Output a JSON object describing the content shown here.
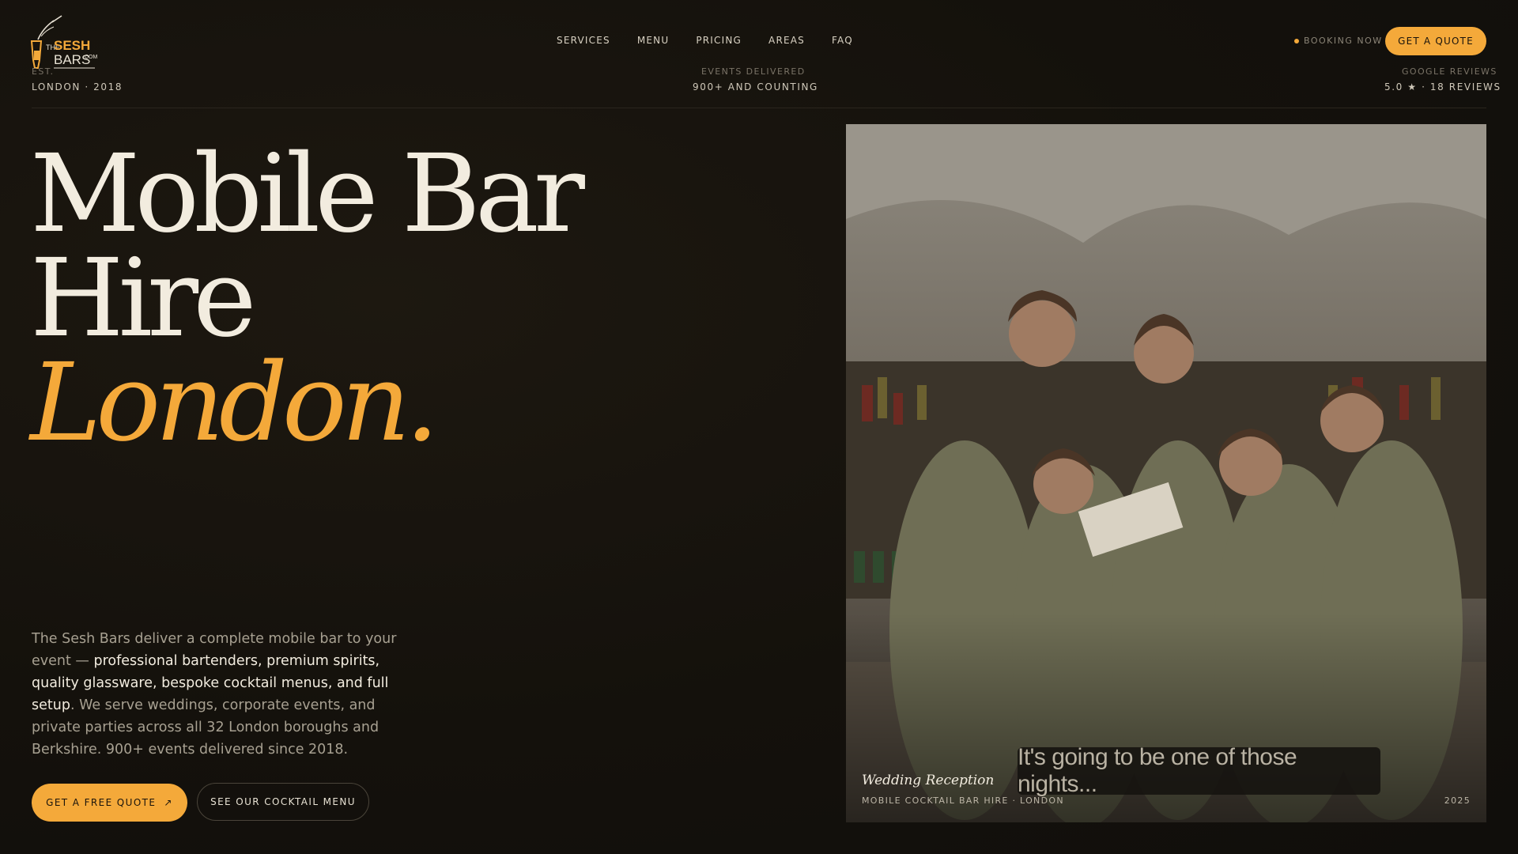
{
  "brand": {
    "logo_the": "THE",
    "logo_sesh": "SESH",
    "logo_bars": "BARS",
    "logo_com": ".COM",
    "accent_color": "#f4a93a"
  },
  "nav": {
    "items": [
      {
        "label": "SERVICES"
      },
      {
        "label": "MENU"
      },
      {
        "label": "PRICING"
      },
      {
        "label": "AREAS"
      },
      {
        "label": "FAQ"
      }
    ]
  },
  "header": {
    "booking_status": "BOOKING NOW",
    "quote_button": "GET A QUOTE"
  },
  "stats": {
    "est_label": "EST.",
    "est_value": "LONDON · 2018",
    "events_label": "EVENTS DELIVERED",
    "events_value": "900+ AND COUNTING",
    "reviews_label": "GOOGLE REVIEWS",
    "reviews_value": "5.0 ★ · 18 REVIEWS"
  },
  "hero": {
    "line1": "Mobile Bar",
    "line2": "Hire",
    "line3": "London.",
    "desc_part1": "The Sesh Bars deliver a complete mobile bar to your event — ",
    "desc_highlight": "professional bartenders, premium spirits, quality glassware, bespoke cocktail menus, and full setup",
    "desc_part2": ". We serve weddings, corporate events, and private parties across all 32 London boroughs and Berkshire. 900+ events delivered since 2018.",
    "cta_primary": "GET A FREE QUOTE",
    "cta_primary_icon": "↗",
    "cta_secondary": "SEE OUR COCKTAIL MENU"
  },
  "photo": {
    "title": "Wedding Reception",
    "subtitle": "MOBILE COCKTAIL BAR HIRE · LONDON",
    "year": "2025",
    "caption": "It's going to be one of those nights..."
  }
}
